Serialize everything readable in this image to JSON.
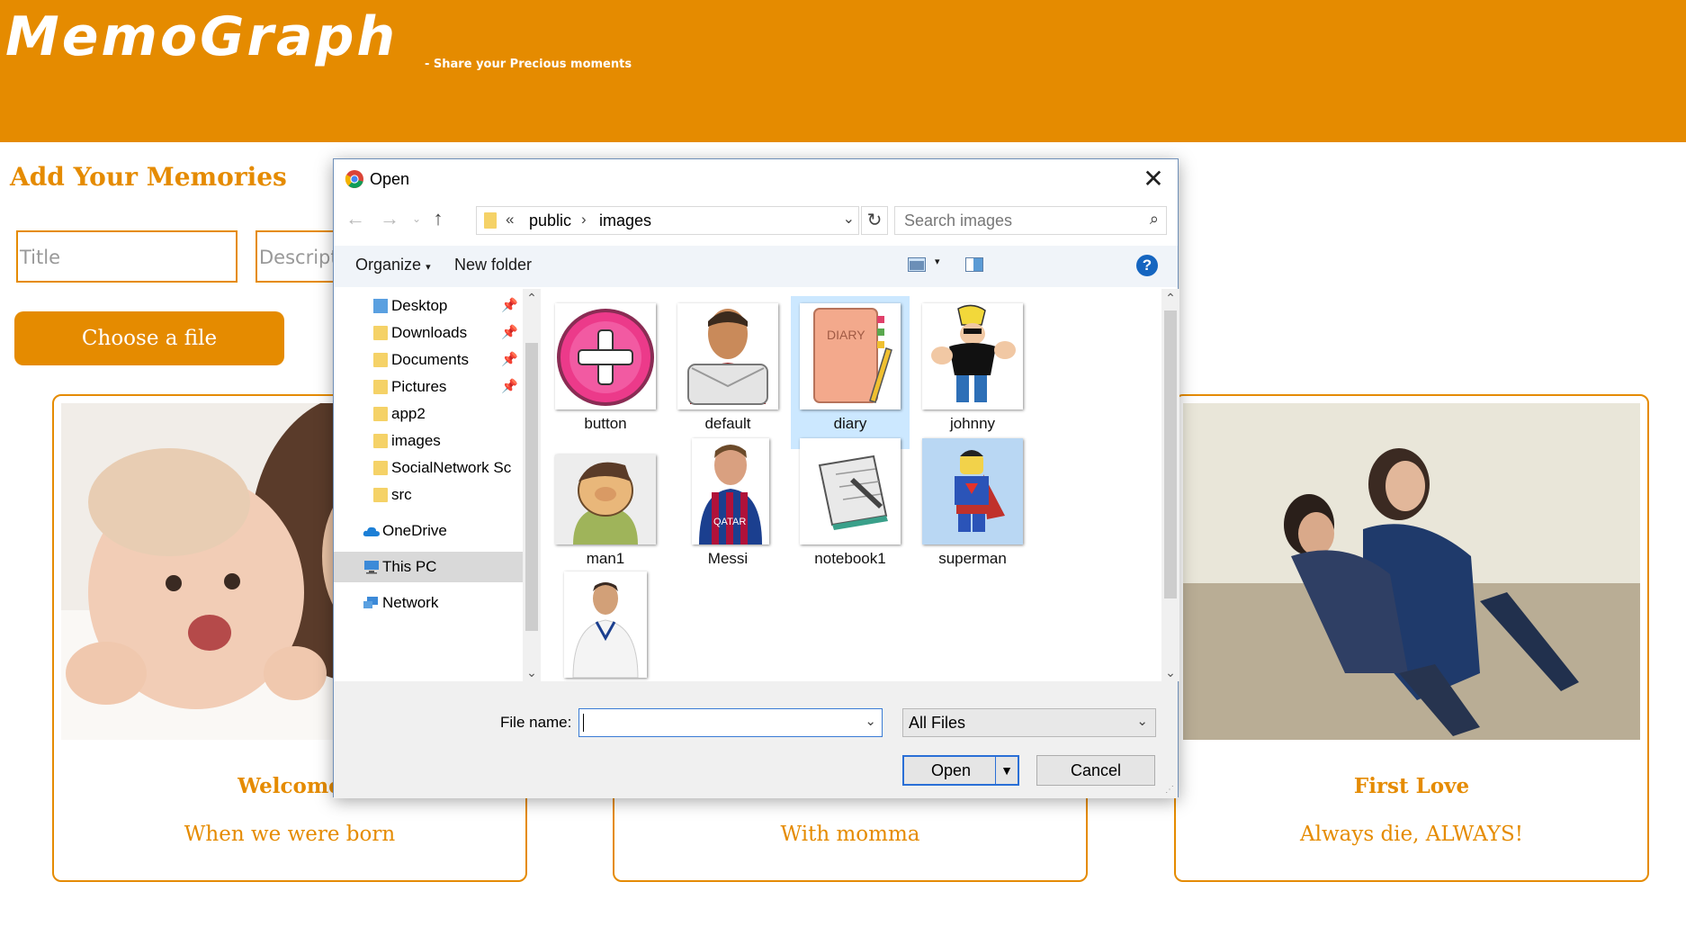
{
  "site": {
    "brand": "MemoGraph",
    "tagline": "- Share your Precious moments",
    "brand_color": "#e58b00"
  },
  "form": {
    "heading": "Add Your Memories",
    "title_placeholder": "Title",
    "description_placeholder": "Descript",
    "choose_file_label": "Choose a file"
  },
  "cards": [
    {
      "title": "Welcome",
      "description": "When we were born"
    },
    {
      "title": "",
      "description": "With momma"
    },
    {
      "title": "First Love",
      "description": "Always die, ALWAYS!"
    }
  ],
  "dialog": {
    "title": "Open",
    "address": {
      "overflow": "«",
      "crumbs": [
        "public",
        "images"
      ]
    },
    "search_placeholder": "Search images",
    "toolbar": {
      "organize": "Organize",
      "new_folder": "New folder",
      "help": "?"
    },
    "nav_items": [
      {
        "label": "Desktop",
        "icon": "desktop-folder-icon",
        "pinned": true
      },
      {
        "label": "Downloads",
        "icon": "downloads-folder-icon",
        "pinned": true
      },
      {
        "label": "Documents",
        "icon": "documents-folder-icon",
        "pinned": true
      },
      {
        "label": "Pictures",
        "icon": "pictures-folder-icon",
        "pinned": true
      },
      {
        "label": "app2",
        "icon": "folder-icon",
        "pinned": false
      },
      {
        "label": "images",
        "icon": "folder-icon",
        "pinned": false
      },
      {
        "label": "SocialNetwork Sc",
        "icon": "folder-icon",
        "pinned": false
      },
      {
        "label": "src",
        "icon": "folder-icon",
        "pinned": false
      },
      {
        "label": "OneDrive",
        "icon": "onedrive-icon",
        "pinned": false
      },
      {
        "label": "This PC",
        "icon": "this-pc-icon",
        "pinned": false,
        "selected": true
      },
      {
        "label": "Network",
        "icon": "network-icon",
        "pinned": false
      }
    ],
    "files": [
      {
        "name": "button",
        "icon": "pink-plus-button-image"
      },
      {
        "name": "default",
        "icon": "default-avatar-image"
      },
      {
        "name": "diary",
        "icon": "diary-image",
        "selected": true
      },
      {
        "name": "johnny",
        "icon": "johnny-bravo-image"
      },
      {
        "name": "man1",
        "icon": "cartoon-man-image"
      },
      {
        "name": "Messi",
        "icon": "messi-photo-image"
      },
      {
        "name": "notebook1",
        "icon": "notebook-image"
      },
      {
        "name": "superman",
        "icon": "lego-superman-image"
      },
      {
        "name": "",
        "icon": "football-player-image"
      }
    ],
    "file_name_label": "File name:",
    "file_name_value": "",
    "file_type": "All Files",
    "open_label": "Open",
    "cancel_label": "Cancel"
  }
}
